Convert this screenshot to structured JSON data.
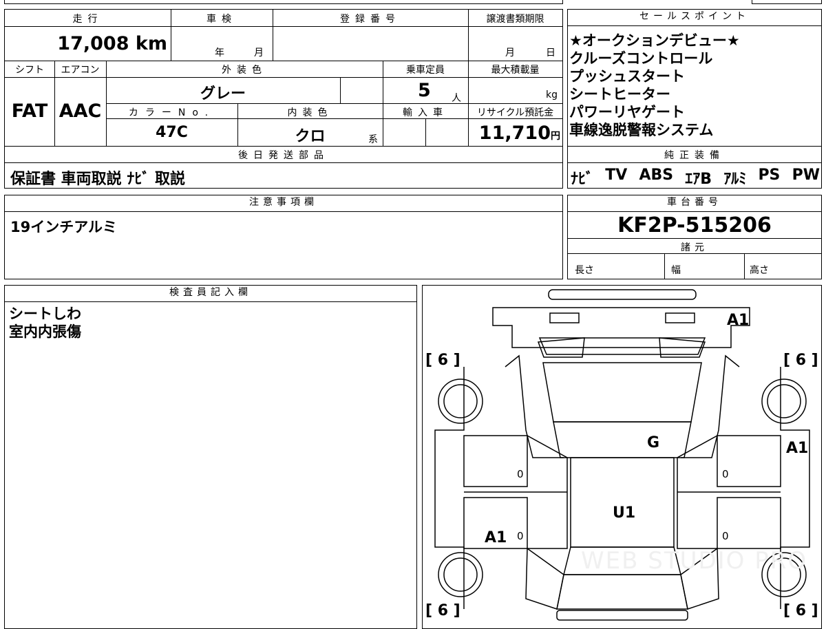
{
  "vehicle": {
    "mileage_label": "走行",
    "mileage_value": "17,008",
    "mileage_unit": "km",
    "inspection_label": "車検",
    "inspection_year": "年",
    "inspection_month": "月",
    "registration_label": "登録番号",
    "transfer_label": "譲渡書類期限",
    "transfer_month": "月",
    "transfer_day": "日",
    "shift_label": "シフト",
    "shift_value": "FAT",
    "ac_label": "エアコン",
    "ac_value": "AAC",
    "exterior_label": "外装色",
    "exterior_value": "グレー",
    "capacity_label": "乗車定員",
    "capacity_value": "5",
    "capacity_unit": "人",
    "load_label": "最大積載量",
    "load_unit": "kg",
    "color_no_label": "カラーNo.",
    "color_no_value": "47C",
    "interior_label": "内装色",
    "interior_value": "クロ",
    "interior_suffix": "系",
    "import_label": "輸入車",
    "recycle_label": "リサイクル預託金",
    "recycle_value": "11,710",
    "recycle_unit": "円",
    "later_label": "後日発送部品",
    "later_value": "保証書 車両取説 ﾅﾋﾞ 取説"
  },
  "sales": {
    "label": "セールスポイント",
    "points": [
      "★オークションデビュー★",
      "クルーズコントロール",
      "プッシュスタート",
      "シートヒーター",
      "パワーリヤゲート",
      "車線逸脱警報システム"
    ]
  },
  "equipment": {
    "label": "純正装備",
    "items": [
      "ﾅﾋﾞ",
      "TV",
      "ABS",
      "ｴｱB",
      "ｱﾙﾐ",
      "PS",
      "PW"
    ]
  },
  "notes": {
    "label": "注意事項欄",
    "text": "19インチアルミ"
  },
  "chassis": {
    "label": "車台番号",
    "value": "KF2P-515206",
    "spec_label": "諸元",
    "length_label": "長さ",
    "width_label": "幅",
    "height_label": "高さ"
  },
  "inspector": {
    "label": "検査員記入欄",
    "lines": [
      "シートしわ",
      "室内内張傷"
    ]
  },
  "diagram": {
    "tires": {
      "fl": "[ 6 ]",
      "fr": "[ 6 ]",
      "rl": "[ 6 ]",
      "rr": "[ 6 ]"
    },
    "marks": {
      "hood": "A1",
      "right_front": "A1",
      "windshield": "G",
      "roof": "U1",
      "left_rear": "A1"
    },
    "levels": {
      "left_front_door": "0",
      "left_rear_door": "0",
      "right_front_door": "0",
      "right_rear_door": "0"
    },
    "watermark": "WEB STUDIO PRO"
  }
}
